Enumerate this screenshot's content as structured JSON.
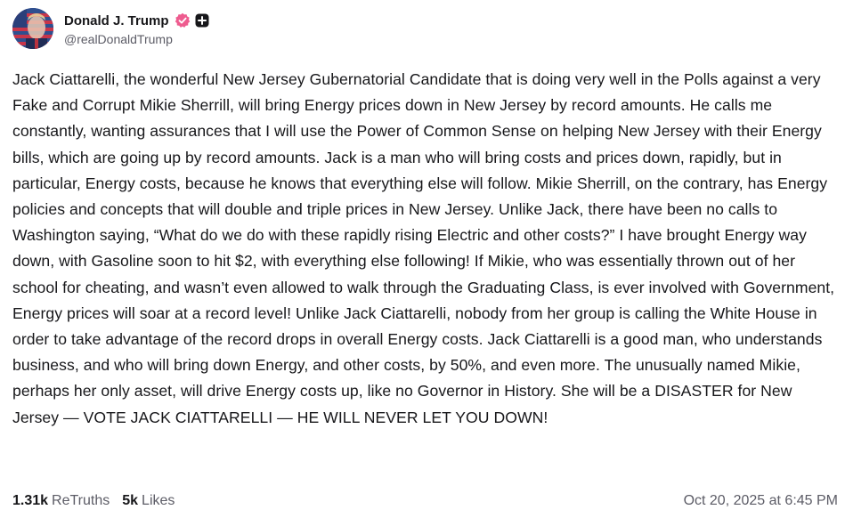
{
  "author": {
    "display_name": "Donald J. Trump",
    "handle": "@realDonaldTrump",
    "avatar": "flag-portrait-avatar",
    "verified_icon": "verified-badge-icon",
    "plus_icon": "plus-badge-icon",
    "verified_color": "#ee5c8f"
  },
  "post": {
    "text": "Jack Ciattarelli, the wonderful New Jersey Gubernatorial Candidate that is doing very well in the Polls against a very Fake and Corrupt Mikie Sherrill, will bring Energy prices down in New Jersey by record amounts. He calls me constantly, wanting assurances that I will use the Power of Common Sense on helping New Jersey with their Energy bills, which are going up by record amounts. Jack is a man who will bring costs and prices down, rapidly, but in particular, Energy costs, because he knows that everything else will follow. Mikie Sherrill, on the contrary, has Energy policies and concepts that will double and triple prices in New Jersey. Unlike Jack, there have been no calls to Washington saying, “What do we do with these rapidly rising Electric and other costs?” I have brought Energy way down, with Gasoline soon to hit $2, with everything else following! If Mikie, who was essentially thrown out of her school for cheating, and wasn’t even allowed to walk through the Graduating Class, is ever involved with Government, Energy prices will soar at a record level! Unlike Jack Ciattarelli, nobody from her group is calling the White House in order to take advantage of the record drops in overall Energy costs. Jack Ciattarelli is a good man, who understands business, and who will bring down Energy, and other costs, by 50%, and even more. The unusually named Mikie, perhaps her only asset, will drive Energy costs up, like no Governor in History. She will be a DISASTER for New Jersey — VOTE JACK CIATTARELLI — HE WILL NEVER LET YOU DOWN!"
  },
  "stats": {
    "retruths_count": "1.31k",
    "retruths_label": "ReTruths",
    "likes_count": "5k",
    "likes_label": "Likes"
  },
  "timestamp": "Oct 20, 2025 at 6:45 PM"
}
